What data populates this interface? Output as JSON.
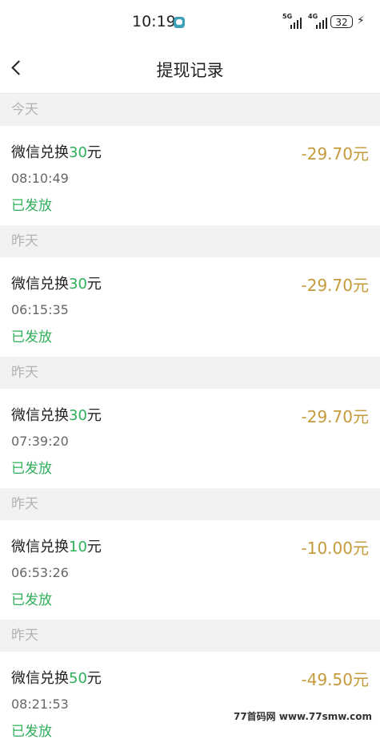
{
  "status": {
    "time": "10:19",
    "sim1": "5G",
    "sim2": "4G",
    "battery": "32"
  },
  "nav": {
    "title": "提现记录"
  },
  "groups": [
    {
      "header": "今天",
      "record": {
        "title_prefix": "微信兑换",
        "amount": "30",
        "title_suffix": "元",
        "time": "08:10:49",
        "status": "已发放",
        "value": "-29.70元"
      }
    },
    {
      "header": "昨天",
      "record": {
        "title_prefix": "微信兑换",
        "amount": "30",
        "title_suffix": "元",
        "time": "06:15:35",
        "status": "已发放",
        "value": "-29.70元"
      }
    },
    {
      "header": "昨天",
      "record": {
        "title_prefix": "微信兑换",
        "amount": "30",
        "title_suffix": "元",
        "time": "07:39:20",
        "status": "已发放",
        "value": "-29.70元"
      }
    },
    {
      "header": "昨天",
      "record": {
        "title_prefix": "微信兑换",
        "amount": "10",
        "title_suffix": "元",
        "time": "06:53:26",
        "status": "已发放",
        "value": "-10.00元"
      }
    },
    {
      "header": "昨天",
      "record": {
        "title_prefix": "微信兑换",
        "amount": "50",
        "title_suffix": "元",
        "time": "08:21:53",
        "status": "已发放",
        "value": "-49.50元"
      }
    }
  ],
  "watermark": "77首码网 www.77smw.com"
}
